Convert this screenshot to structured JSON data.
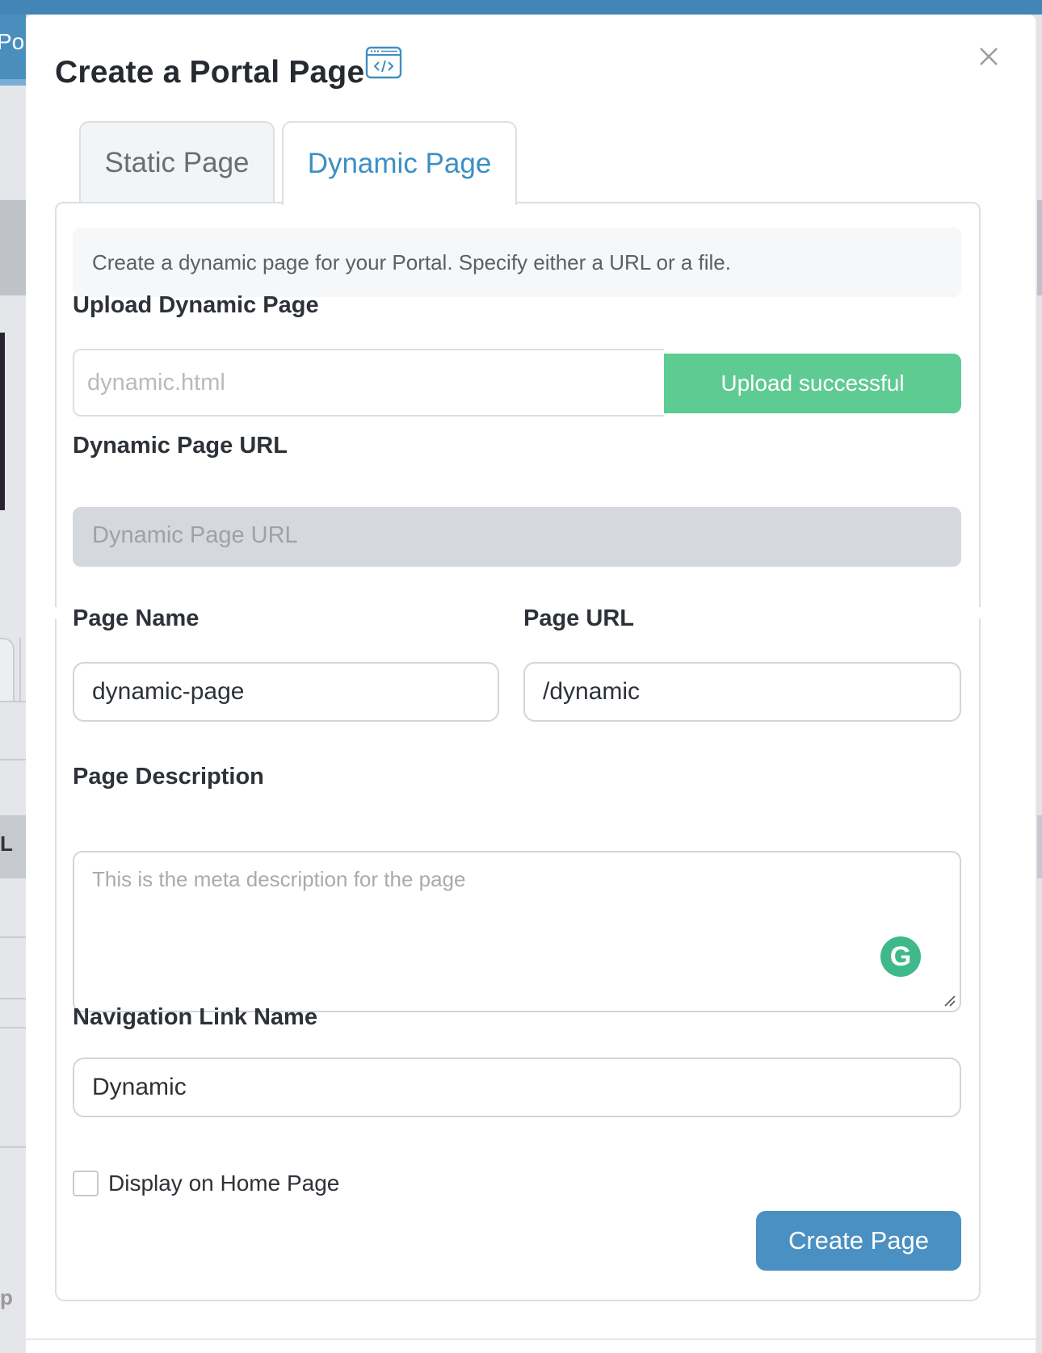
{
  "background": {
    "nav_fragment": "Po",
    "row_label_fragment": "L",
    "bottom_text_fragment": "p"
  },
  "modal": {
    "title": "Create a Portal Page",
    "title_icon": "code-window-icon",
    "close_icon": "close-icon"
  },
  "tabs": [
    {
      "label": "Static Page",
      "active": false
    },
    {
      "label": "Dynamic Page",
      "active": true
    }
  ],
  "dynamic": {
    "info_text": "Create a dynamic page for your Portal. Specify either a URL or a file.",
    "upload_label": "Upload Dynamic Page",
    "upload_filename": "dynamic.html",
    "upload_status": "Upload successful",
    "url_label": "Dynamic Page URL",
    "url_placeholder": "Dynamic Page URL"
  },
  "form": {
    "page_name_label": "Page Name",
    "page_name_value": "dynamic-page",
    "page_url_label": "Page URL",
    "page_url_value": "/dynamic",
    "description_label": "Page Description",
    "description_placeholder": "This is the meta description for the page",
    "nav_link_label": "Navigation Link Name",
    "nav_link_value": "Dynamic",
    "display_home_label": "Display on Home Page",
    "display_home_checked": false,
    "submit_label": "Create Page"
  },
  "colors": {
    "accent": "#4a90c2",
    "tab_active_text": "#3d8fc2",
    "success": "#5ecb92",
    "grammarly": "#3fb98c"
  }
}
